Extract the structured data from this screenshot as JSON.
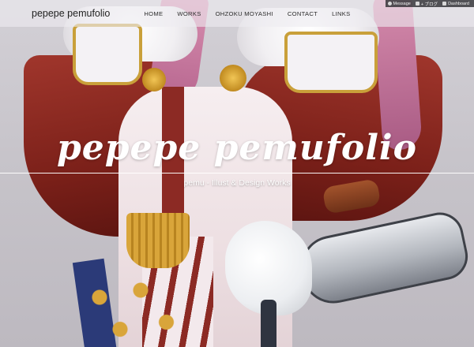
{
  "header": {
    "brand": "pepepe pemufolio",
    "nav": [
      {
        "label": "HOME"
      },
      {
        "label": "WORKS"
      },
      {
        "label": "OHZOKU MOYASHI"
      },
      {
        "label": "CONTACT"
      },
      {
        "label": "LINKS"
      }
    ]
  },
  "adminbar": {
    "items": [
      {
        "label": "Message",
        "icon": "comment-icon"
      },
      {
        "label": "+ ブログ",
        "icon": "plus-icon"
      },
      {
        "label": "Dashboard",
        "icon": "home-icon"
      }
    ]
  },
  "hero": {
    "title": "pepepe pemufolio",
    "subtitle": "pemu - Illust & Design Works"
  }
}
